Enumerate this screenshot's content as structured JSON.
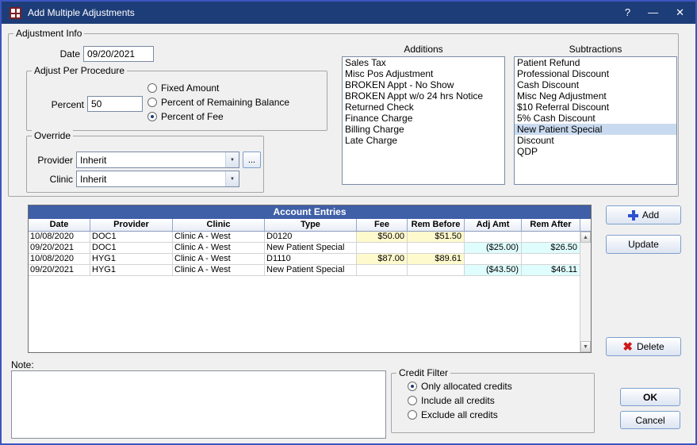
{
  "colors": {
    "titlebar": "#1d3d78",
    "grid_title": "#3f5fa7",
    "fee_cell": "#fffacd",
    "adj_cell": "#dffdfd",
    "selection": "#c9daf0"
  },
  "icons": {
    "chevron_down": "▼",
    "scroll_up": "▲",
    "scroll_down": "▼",
    "red_x": "✖"
  },
  "window": {
    "title": "Add Multiple Adjustments",
    "controls": {
      "help": "?",
      "minimize": "—",
      "close": "✕"
    }
  },
  "adjustment_info": {
    "group_label": "Adjustment Info",
    "date_label": "Date",
    "date_value": "09/20/2021",
    "adjust_per_procedure": {
      "group_label": "Adjust Per Procedure",
      "percent_label": "Percent",
      "percent_value": "50",
      "radios": [
        {
          "label": "Fixed Amount",
          "selected": false
        },
        {
          "label": "Percent of Remaining Balance",
          "selected": false
        },
        {
          "label": "Percent of Fee",
          "selected": true
        }
      ]
    },
    "override": {
      "group_label": "Override",
      "provider_label": "Provider",
      "provider_value": "Inherit",
      "ellipsis": "...",
      "clinic_label": "Clinic",
      "clinic_value": "Inherit"
    },
    "additions": {
      "label": "Additions",
      "items": [
        "Sales Tax",
        "Misc Pos Adjustment",
        "BROKEN Appt - No Show",
        "BROKEN Appt w/o 24 hrs Notice",
        "Returned Check",
        "Finance Charge",
        "Billing Charge",
        "Late Charge"
      ],
      "selected_index": -1
    },
    "subtractions": {
      "label": "Subtractions",
      "items": [
        "Patient Refund",
        "Professional Discount",
        "Cash Discount",
        "Misc Neg Adjustment",
        "$10 Referral Discount",
        "5% Cash Discount",
        "New Patient Special",
        "Discount",
        "QDP"
      ],
      "selected_index": 6
    }
  },
  "grid": {
    "title": "Account Entries",
    "columns": [
      "Date",
      "Provider",
      "Clinic",
      "Type",
      "Fee",
      "Rem Before",
      "Adj Amt",
      "Rem After"
    ],
    "rows": [
      [
        "10/08/2020",
        "DOC1",
        "Clinic A - West",
        "D0120",
        "$50.00",
        "$51.50",
        "",
        ""
      ],
      [
        "09/20/2021",
        "DOC1",
        "Clinic A - West",
        "New Patient Special",
        "",
        "",
        "($25.00)",
        "$26.50"
      ],
      [
        "10/08/2020",
        "HYG1",
        "Clinic A - West",
        "D1110",
        "$87.00",
        "$89.61",
        "",
        ""
      ],
      [
        "09/20/2021",
        "HYG1",
        "Clinic A - West",
        "New Patient Special",
        "",
        "",
        "($43.50)",
        "$46.11"
      ]
    ]
  },
  "buttons": {
    "add": {
      "label": "Add",
      "icon": "plus-icon"
    },
    "update": {
      "label": "Update"
    },
    "delete": {
      "label": "Delete",
      "icon": "red-x-icon"
    },
    "ok": {
      "label": "OK"
    },
    "cancel": {
      "label": "Cancel"
    }
  },
  "note": {
    "label": "Note:",
    "value": ""
  },
  "credit_filter": {
    "group_label": "Credit Filter",
    "radios": [
      {
        "label": "Only allocated credits",
        "selected": true
      },
      {
        "label": "Include all credits",
        "selected": false
      },
      {
        "label": "Exclude all credits",
        "selected": false
      }
    ]
  }
}
